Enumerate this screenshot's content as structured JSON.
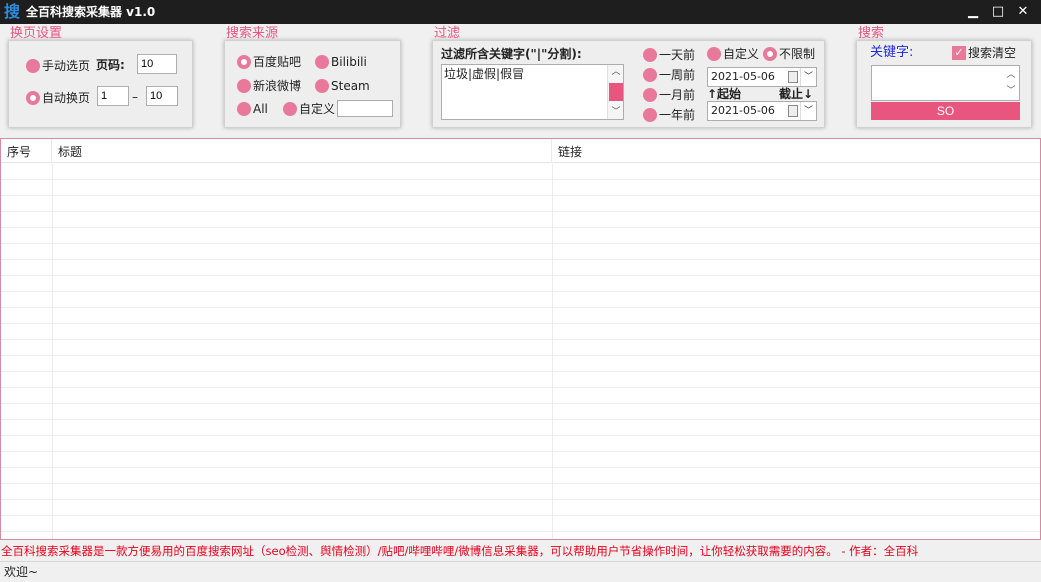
{
  "window": {
    "icon_glyph": "搜",
    "title": "全百科搜索采集器 v1.0",
    "minimize_glyph": "▁",
    "maximize_glyph": "□",
    "close_glyph": "✕"
  },
  "paging": {
    "title": "换页设置",
    "manual_label": "手动选页",
    "page_label": "页码:",
    "page_value": "10",
    "auto_label": "自动换页",
    "range_from": "1",
    "range_sep": "–",
    "range_to": "10"
  },
  "source": {
    "title": "搜索来源",
    "options": [
      "百度贴吧",
      "Bilibili",
      "新浪微博",
      "Steam",
      "All",
      "自定义"
    ],
    "custom_value": ""
  },
  "filter": {
    "title": "过滤",
    "keyword_label": "过滤所含关键字(\"|\"分割):",
    "keyword_value": "垃圾|虚假|假冒",
    "time_options": [
      "一天前",
      "一周前",
      "一月前",
      "一年前"
    ],
    "custom_label": "自定义",
    "unlimited_label": "不限制",
    "start_date": "2021-05-06",
    "start_label": "↑起始",
    "end_label": "截止↓",
    "end_date": "2021-05-06"
  },
  "search": {
    "title": "搜索",
    "keyword_label": "关键字:",
    "clear_label": "搜索清空",
    "clear_checked": true,
    "keyword_value": "",
    "so_button": "SO"
  },
  "table": {
    "columns": [
      "序号",
      "标题",
      "链接"
    ]
  },
  "footer": {
    "note": "全百科搜索采集器是一款方便易用的百度搜索网址（seo检测、舆情检测）/贴吧/哔哩哔哩/微博信息采集器，可以帮助用户节省操作时间，让你轻松获取需要的内容。 - 作者：全百科",
    "status": "欢迎~"
  },
  "colors": {
    "accent": "#e8557f",
    "radio": "#e8799a",
    "titlebar": "#1e1e1e",
    "footer_text": "#e8001c"
  }
}
